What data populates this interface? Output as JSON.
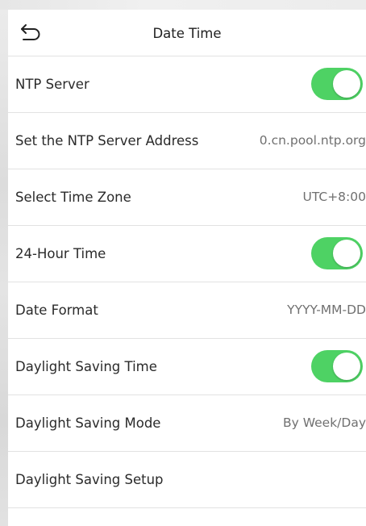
{
  "header": {
    "back_icon": "back-arrow-icon",
    "title": "Date Time"
  },
  "colors": {
    "toggle_on": "#4ed264",
    "label_text": "#2a2a2a",
    "value_text": "#707070",
    "divider": "#e2e2e2"
  },
  "rows": {
    "ntp_server": {
      "label": "NTP Server",
      "enabled": true
    },
    "ntp_address": {
      "label": "Set the NTP Server Address",
      "value": "0.cn.pool.ntp.org"
    },
    "time_zone": {
      "label": "Select Time Zone",
      "value": "UTC+8:00"
    },
    "hour24": {
      "label": "24-Hour Time",
      "enabled": true
    },
    "date_format": {
      "label": "Date Format",
      "value": "YYYY-MM-DD"
    },
    "dst": {
      "label": "Daylight Saving Time",
      "enabled": true
    },
    "dst_mode": {
      "label": "Daylight Saving Mode",
      "value": "By Week/Day"
    },
    "dst_setup": {
      "label": "Daylight Saving Setup"
    }
  }
}
